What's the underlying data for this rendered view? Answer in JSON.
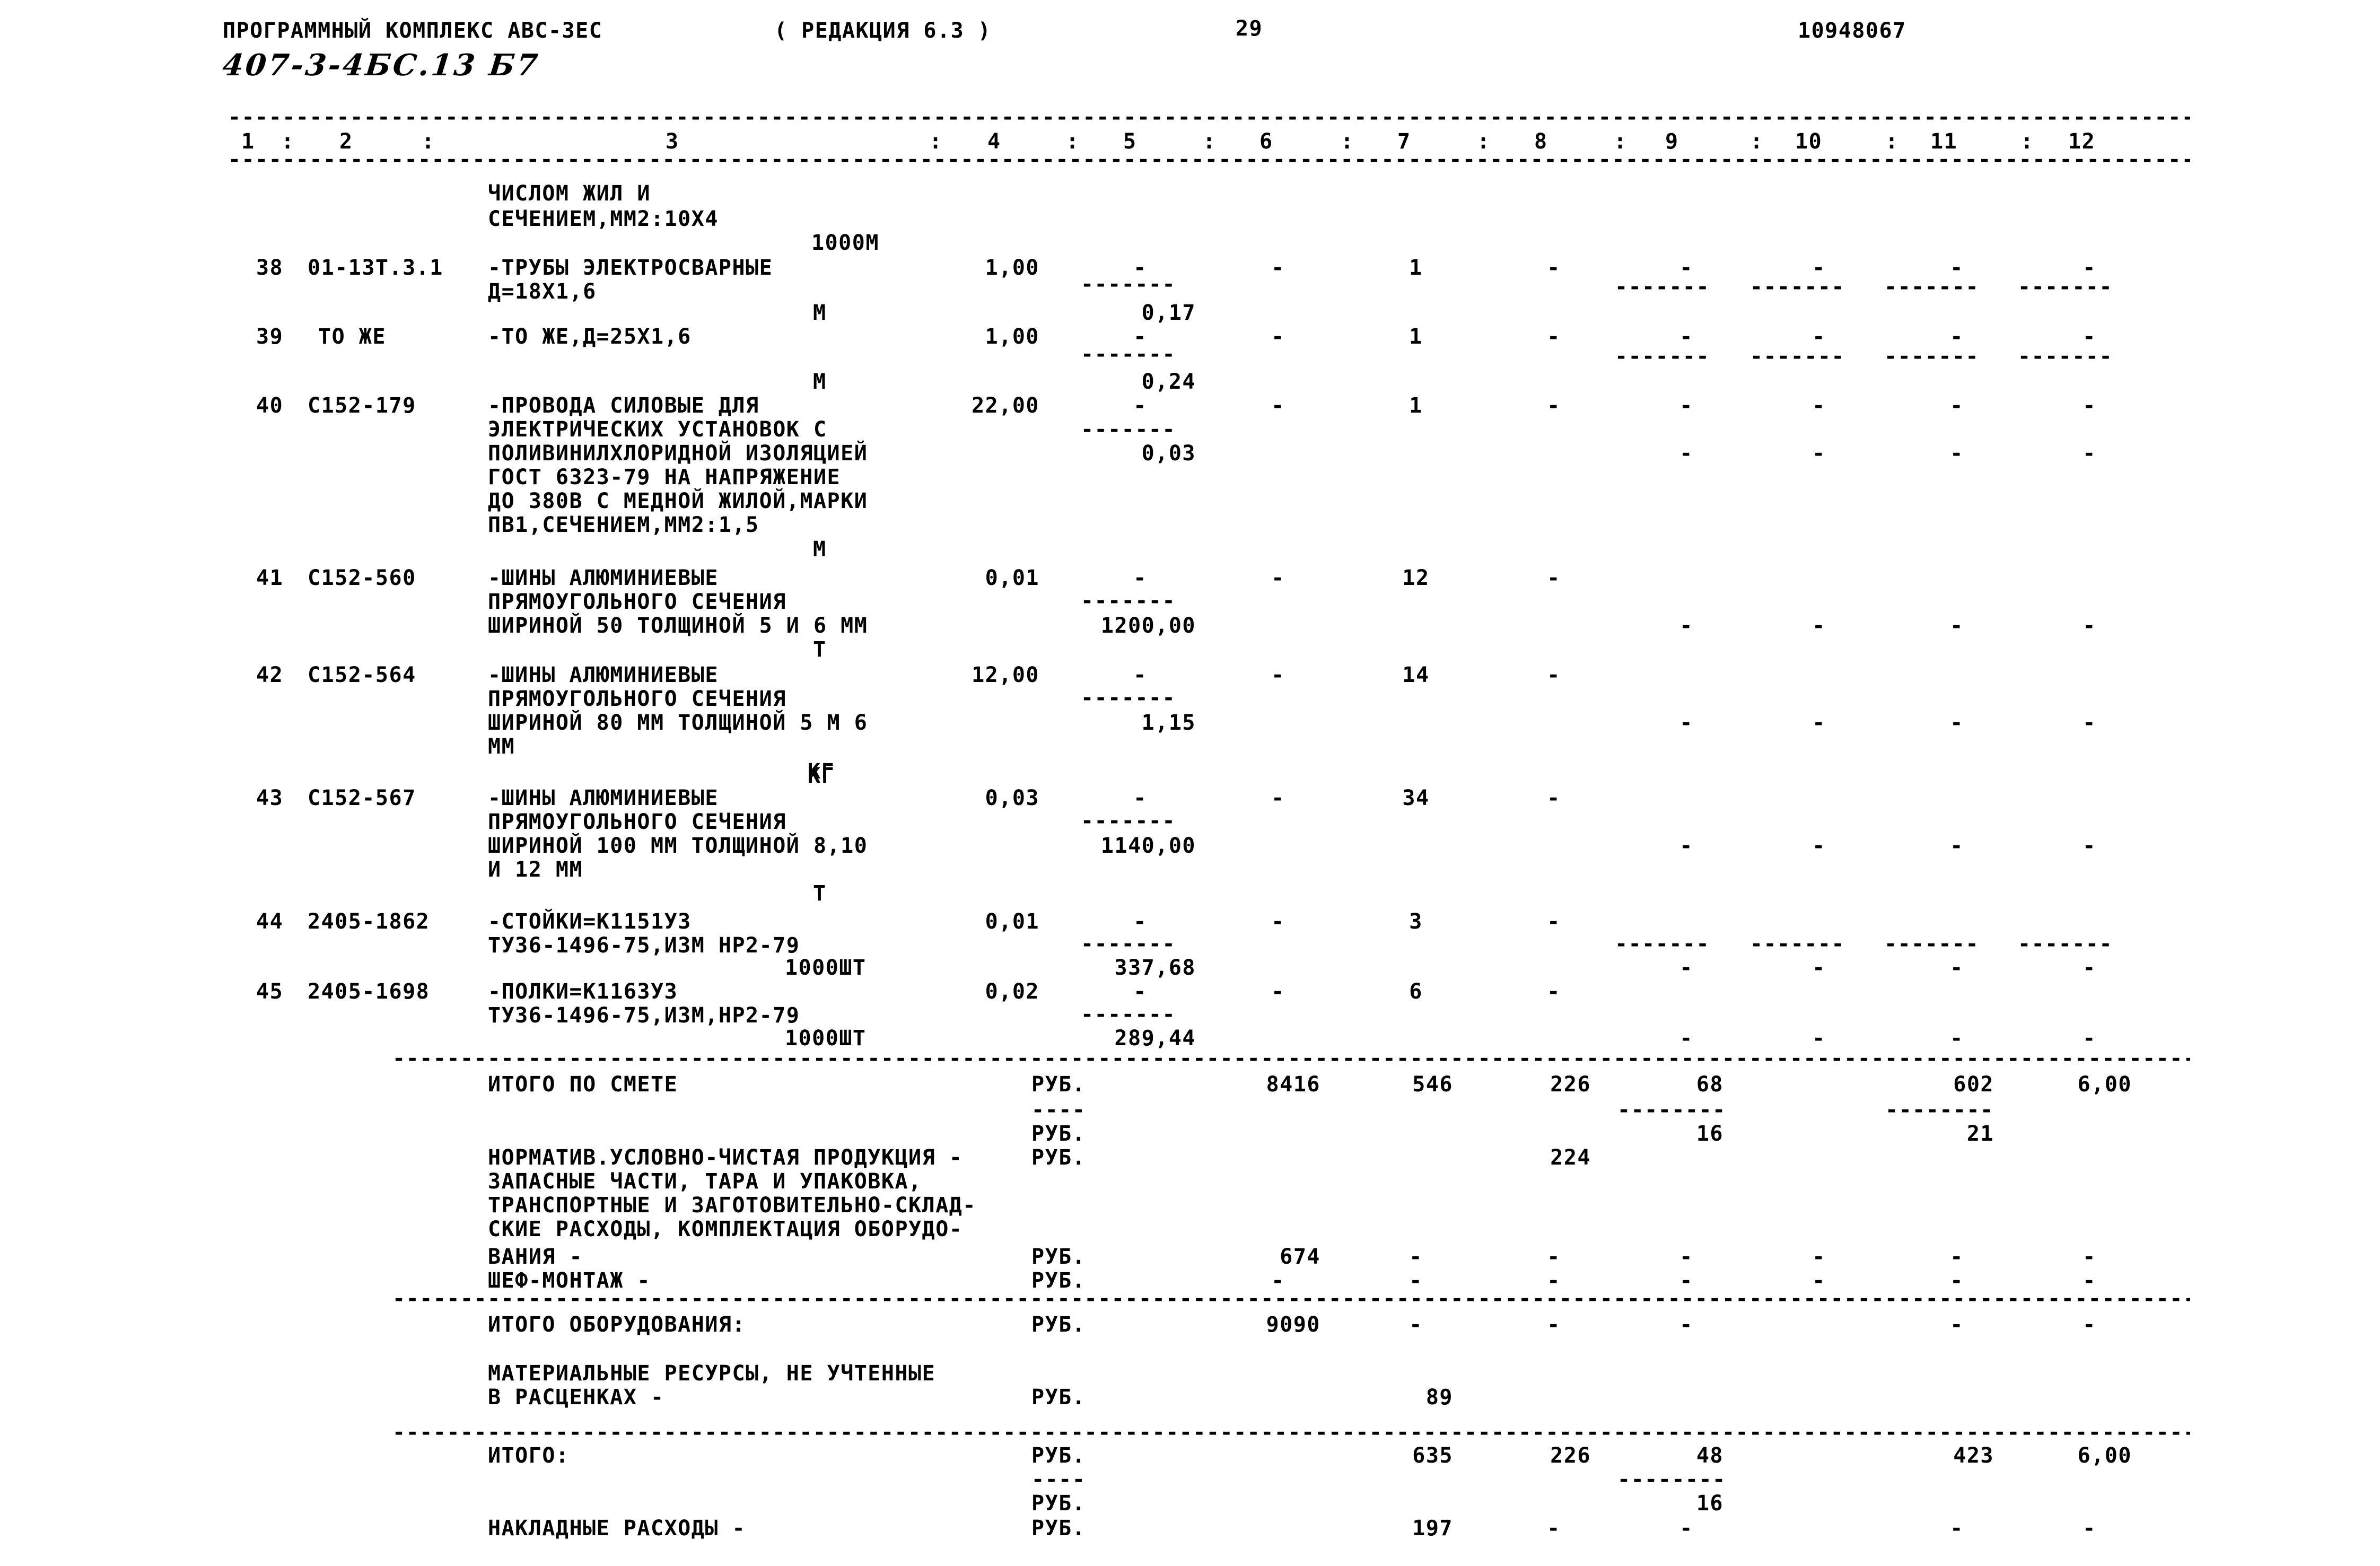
{
  "header": {
    "program_title": "ПРОГРАММНЫЙ КОМПЛЕКС АВС-ЗЕС",
    "edition": "( РЕДАКЦИЯ 6.3 )",
    "page_marker": "29",
    "doc_number": "10948067",
    "handwritten_code": "407-3-4БС.13 Б7"
  },
  "column_header": {
    "cells": [
      "1",
      ":",
      "2",
      ":",
      "3",
      ":",
      "4",
      ":",
      "5",
      ":",
      "6",
      ":",
      "7",
      ":",
      "8",
      ":",
      "9",
      ":",
      "10",
      ":",
      "11",
      ":",
      "12"
    ],
    "numbers": [
      "1",
      "2",
      "3",
      "4",
      "5",
      "6",
      "7",
      "8",
      "9",
      "10",
      "11",
      "12"
    ],
    "separator": ":"
  },
  "rules": {
    "dash": "-",
    "short_dash_group": "-------",
    "short_dash_group4": "----"
  },
  "continued_item": {
    "line1": "ЧИСЛОМ ЖИЛ И",
    "line2": "СЕЧЕНИЕМ,ММ2:10Х4",
    "unit": "1000М"
  },
  "rows": [
    {
      "num": "38",
      "code": "01-13Т.3.1",
      "desc": [
        "-ТРУБЫ ЭЛЕКТРОСВАРНЫЕ",
        "Д=18Х1,6"
      ],
      "unit": "М",
      "qty": "1,00",
      "c5_dash": "-------",
      "c5": "0,17",
      "c6": "-",
      "c7": "1",
      "c8": "-",
      "c9": "-",
      "c10": "-",
      "c11": "-",
      "c12": "-",
      "dash_row": [
        "-------",
        "-------",
        "-------",
        "-------"
      ]
    },
    {
      "num": "39",
      "code": "ТО ЖЕ",
      "desc": [
        "-ТО ЖЕ,Д=25Х1,6"
      ],
      "unit": "М",
      "qty": "1,00",
      "c5_dash": "-------",
      "c5": "0,24",
      "c6": "-",
      "c7": "1",
      "c8": "-",
      "c9": "-",
      "c10": "-",
      "c11": "-",
      "c12": "-",
      "dash_row": [
        "-------",
        "-------",
        "-------",
        "-------"
      ]
    },
    {
      "num": "40",
      "code": "С152-179",
      "desc": [
        "-ПРОВОДА СИЛОВЫЕ ДЛЯ",
        "ЭЛЕКТРИЧЕСКИХ УСТАНОВОК С",
        "ПОЛИВИНИЛХЛОРИДНОЙ ИЗОЛЯЦИЕЙ",
        "ГОСТ 6323-79 НА НАПРЯЖЕНИЕ",
        "ДО 380В С МЕДНОЙ ЖИЛОЙ,МАРКИ",
        "ПВ1,СЕЧЕНИЕМ,ММ2:1,5"
      ],
      "unit": "М",
      "qty": "22,00",
      "c5_dash": "-------",
      "c5": "0,03",
      "c6": "-",
      "c7": "1",
      "c8": "-",
      "c9": "-",
      "c10": "-",
      "c11": "-",
      "c12": "-"
    },
    {
      "num": "41",
      "code": "С152-560",
      "desc": [
        "-ШИНЫ АЛЮМИНИЕВЫЕ",
        "ПРЯМОУГОЛЬНОГО СЕЧЕНИЯ",
        "ШИРИНОЙ 50 ТОЛЩИНОЙ 5 И 6 ММ"
      ],
      "unit": "Т",
      "qty": "0,01",
      "c5_dash": "-------",
      "c5": "1200,00",
      "c6": "-",
      "c7": "12",
      "c8": "-",
      "c9": "-",
      "c10": "-",
      "c11": "-",
      "c12": "-"
    },
    {
      "num": "42",
      "code": "С152-564",
      "desc": [
        "-ШИНЫ АЛЮМИНИЕВЫЕ",
        "ПРЯМОУГОЛЬНОГО СЕЧЕНИЯ",
        "ШИРИНОЙ 80 ММ ТОЛЩИНОЙ 5 М 6",
        "ММ"
      ],
      "unit": "КГ",
      "qty": "12,00",
      "c5_dash": "-------",
      "c5": "1,15",
      "c6": "-",
      "c7": "14",
      "c8": "-",
      "c9": "-",
      "c10": "-",
      "c11": "-",
      "c12": "-"
    },
    {
      "num": "43",
      "code": "С152-567",
      "desc": [
        "-ШИНЫ АЛЮМИНИЕВЫЕ",
        "ПРЯМОУГОЛЬНОГО СЕЧЕНИЯ",
        "ШИРИНОЙ 100 ММ ТОЛЩИНОЙ 8,10",
        "И 12 ММ"
      ],
      "unit": "Т",
      "qty": "0,03",
      "c5_dash": "-------",
      "c5": "1140,00",
      "c6": "-",
      "c7": "34",
      "c8": "-",
      "c9": "-",
      "c10": "-",
      "c11": "-",
      "c12": "-"
    },
    {
      "num": "44",
      "code": "2405-1862",
      "desc": [
        "-СТОЙКИ=К1151У3",
        "ТУ36-1496-75,ИЗМ НР2-79"
      ],
      "unit": "1000ШТ",
      "qty": "0,01",
      "c5_dash": "-------",
      "c5": "337,68",
      "c6": "-",
      "c7": "3",
      "c8": "-",
      "c9": "-",
      "c10": "-",
      "c11": "-",
      "c12": "-"
    },
    {
      "num": "45",
      "code": "2405-1698",
      "desc": [
        "-ПОЛКИ=К1163У3",
        "ТУ36-1496-75,ИЗМ,НР2-79"
      ],
      "unit": "1000ШТ",
      "qty": "0,02",
      "c5_dash": "-------",
      "c5": "289,44",
      "c6": "-",
      "c7": "6",
      "c8": "-",
      "c9": "-",
      "c10": "-",
      "c11": "-",
      "c12": "-"
    }
  ],
  "totals": {
    "currency": "РУБ.",
    "smeta": {
      "label": "ИТОГО ПО СМЕТЕ",
      "c6": "8416",
      "c7": "546",
      "c8": "226",
      "c9": "68",
      "c11": "602",
      "c12": "6,00",
      "sub_dash": "--------",
      "c9_sub": "16",
      "c11_sub": "21"
    },
    "normativ": {
      "lines": [
        "НОРМАТИВ.УСЛОВНО-ЧИСТАЯ ПРОДУКЦИЯ -",
        "ЗАПАСНЫЕ ЧАСТИ, ТАРА И УПАКОВКА,",
        "ТРАНСПОРТНЫЕ И ЗАГОТОВИТЕЛЬНО-СКЛАД-",
        "СКИЕ РАСХОДЫ, КОМПЛЕКТАЦИЯ ОБОРУДО-",
        "ВАНИЯ -"
      ],
      "c8": "224",
      "vaniya_c6": "674",
      "vaniya_rest": "-"
    },
    "shefmontazh": {
      "label": "ШЕФ-МОНТАЖ -",
      "all": "-"
    },
    "oborudovaniya": {
      "label": "ИТОГО ОБОРУДОВАНИЯ:",
      "c6": "9090",
      "rest": "-"
    },
    "material": {
      "lines": [
        "МАТЕРИАЛЬНЫЕ РЕСУРСЫ, НЕ УЧТЕННЫЕ",
        "В РАСЦЕНКАХ -"
      ],
      "c7": "89"
    },
    "itogo": {
      "label": "ИТОГО:",
      "c7": "635",
      "c8": "226",
      "c9": "48",
      "c11": "423",
      "c12": "6,00",
      "sub_dash": "--------",
      "c9_sub": "16"
    },
    "nakladnye": {
      "label": "НАКЛАДНЫЕ РАСХОДЫ -",
      "c7": "197",
      "c8": "-",
      "c9": "-",
      "c11": "-",
      "c12": "-"
    }
  }
}
